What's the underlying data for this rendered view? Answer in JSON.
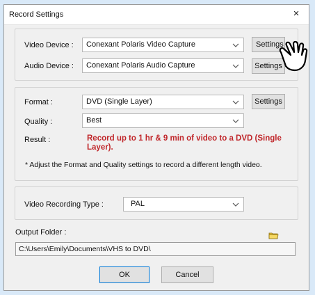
{
  "window": {
    "title": "Record Settings",
    "close_label": "×"
  },
  "devices": {
    "video_label": "Video Device :",
    "video_value": "Conexant Polaris Video Capture",
    "video_settings_label": "Settings",
    "audio_label": "Audio Device :",
    "audio_value": "Conexant Polaris Audio Capture",
    "audio_settings_label": "Settings"
  },
  "format": {
    "format_label": "Format :",
    "format_value": "DVD (Single Layer)",
    "format_settings_label": "Settings",
    "quality_label": "Quality :",
    "quality_value": "Best",
    "result_label": "Result :",
    "result_text": "Record up to 1 hr & 9 min of  video to a DVD (Single Layer).",
    "note": "* Adjust the Format and Quality settings to record a different length video."
  },
  "recording": {
    "type_label": "Video Recording Type :",
    "type_value": "PAL"
  },
  "output": {
    "folder_label": "Output Folder :",
    "folder_path": "C:\\Users\\Emily\\Documents\\VHS to DVD\\"
  },
  "buttons": {
    "ok_label": "OK",
    "cancel_label": "Cancel"
  },
  "icons": {
    "dropdown": "chevron-down-icon",
    "folder": "folder-icon",
    "cursor": "hand-pointer-icon"
  },
  "colors": {
    "result_text": "#c0262a",
    "background": "#d9e9f8",
    "dialog": "#f0f0f0"
  }
}
